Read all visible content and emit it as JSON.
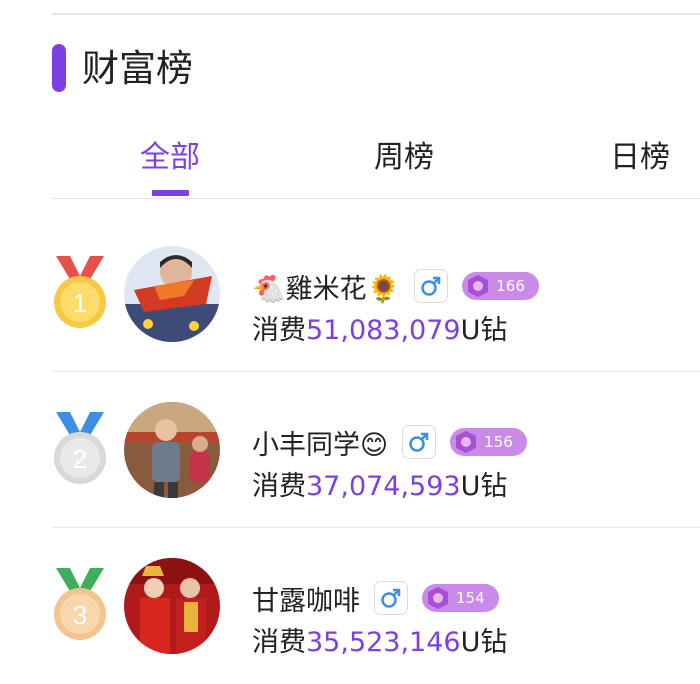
{
  "header": {
    "title": "财富榜"
  },
  "tabs": [
    {
      "label": "全部",
      "active": true
    },
    {
      "label": "周榜",
      "active": false
    },
    {
      "label": "日榜",
      "active": false
    }
  ],
  "spend_prefix": "消费",
  "spend_unit": "U钻",
  "ranking": [
    {
      "rank": "1",
      "prefix_emoji": "🐔",
      "name": "雞米花",
      "suffix_emoji": "🌻",
      "gender": "male",
      "level": "166",
      "amount": "51,083,079"
    },
    {
      "rank": "2",
      "prefix_emoji": "",
      "name": "小丰同学",
      "suffix_emoji": "😊",
      "gender": "male",
      "level": "156",
      "amount": "37,074,593"
    },
    {
      "rank": "3",
      "prefix_emoji": "",
      "name": "甘露咖啡",
      "suffix_emoji": "",
      "gender": "male",
      "level": "154",
      "amount": "35,523,146"
    }
  ],
  "colors": {
    "accent": "#7b3fe4",
    "level_badge": "#c98ae8",
    "gender_male": "#3d8ee6",
    "gold": "#f6c844",
    "silver": "#d9d9d9",
    "bronze": "#f2c48f"
  }
}
